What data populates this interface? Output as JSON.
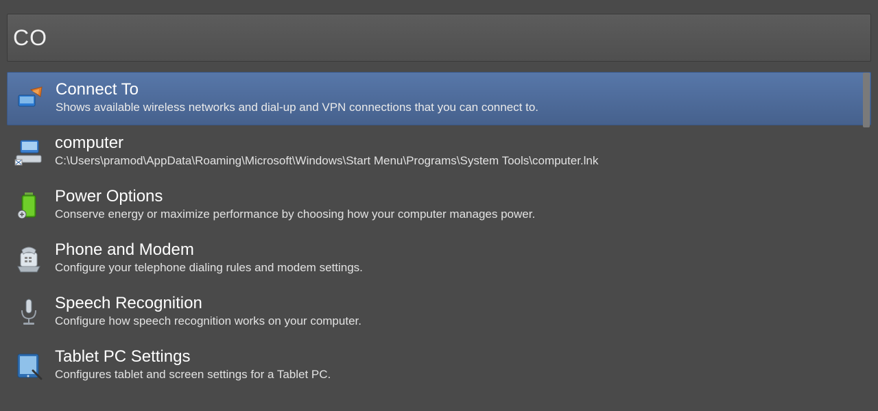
{
  "search": {
    "query": "CO"
  },
  "results": [
    {
      "title": "Connect To",
      "desc": "Shows available wireless networks and dial-up and VPN connections that you can connect to.",
      "icon": "connect-to-icon",
      "selected": true
    },
    {
      "title": "computer",
      "desc": "C:\\Users\\pramod\\AppData\\Roaming\\Microsoft\\Windows\\Start Menu\\Programs\\System Tools\\computer.lnk",
      "icon": "computer-icon",
      "selected": false
    },
    {
      "title": "Power Options",
      "desc": "Conserve energy or maximize performance by choosing how your computer manages power.",
      "icon": "battery-icon",
      "selected": false
    },
    {
      "title": "Phone and Modem",
      "desc": "Configure your telephone dialing rules and modem settings.",
      "icon": "phone-modem-icon",
      "selected": false
    },
    {
      "title": "Speech Recognition",
      "desc": "Configure how speech recognition works on your computer.",
      "icon": "microphone-icon",
      "selected": false
    },
    {
      "title": "Tablet PC Settings",
      "desc": "Configures tablet and screen settings for a Tablet PC.",
      "icon": "tablet-icon",
      "selected": false
    }
  ]
}
